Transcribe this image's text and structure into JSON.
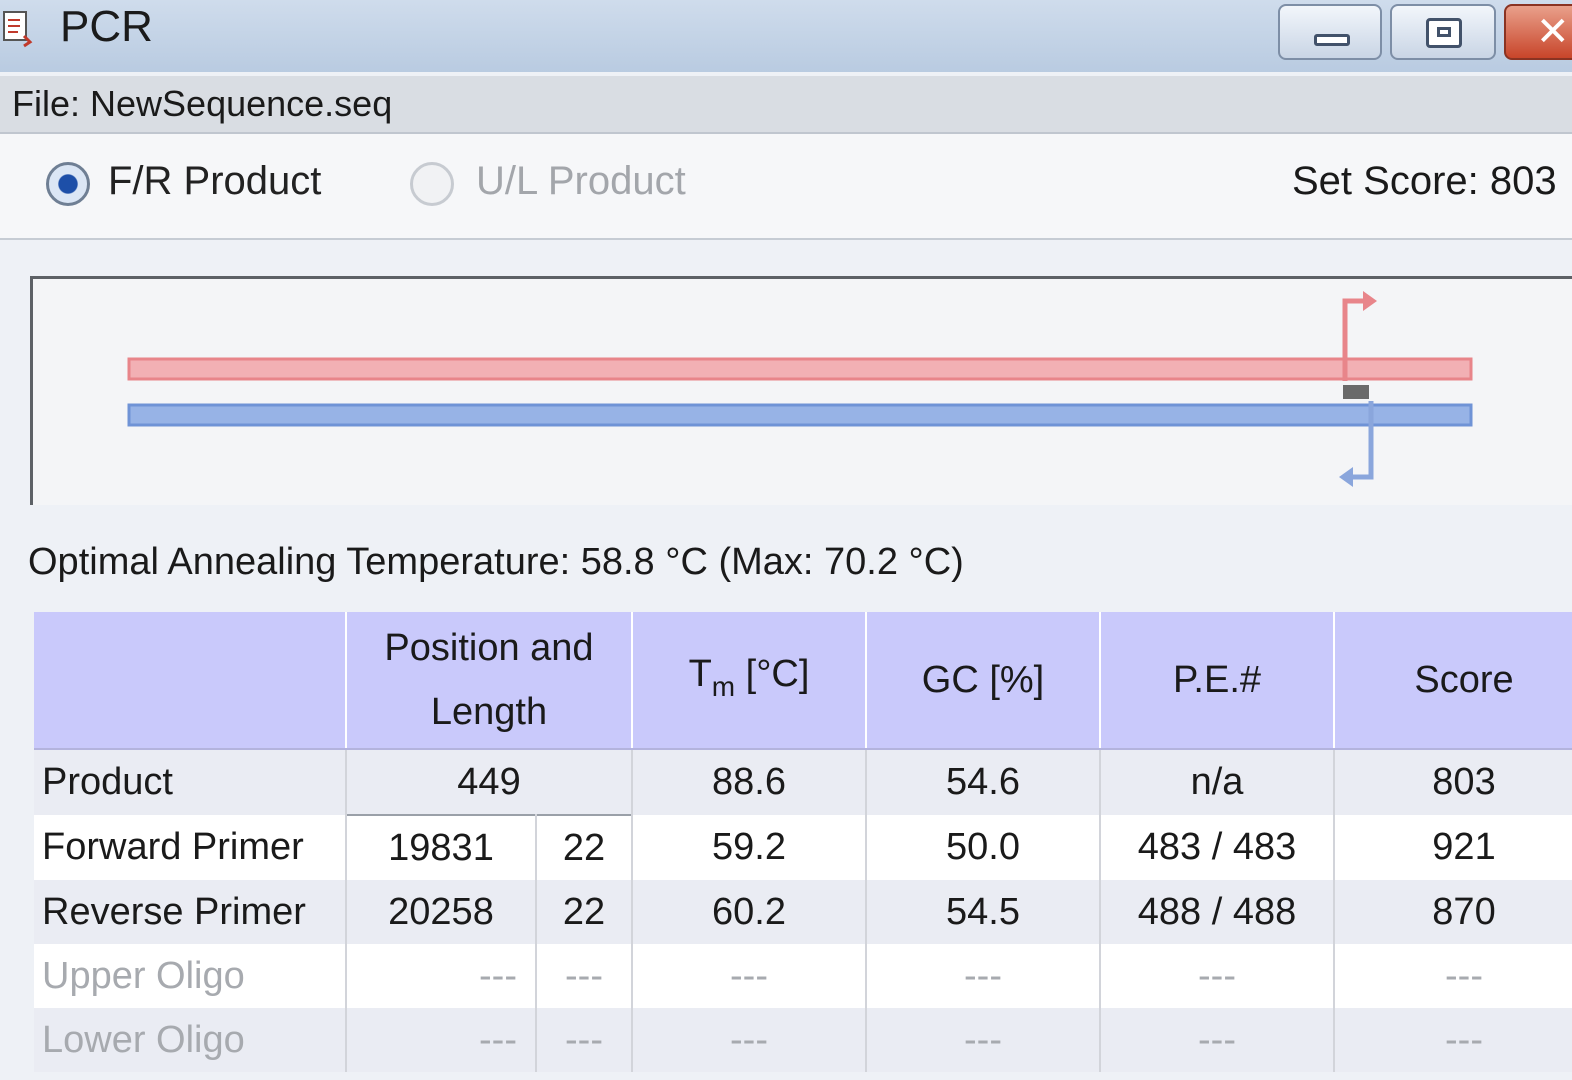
{
  "window": {
    "title": "PCR",
    "buttons": {
      "minimize": "minimize-icon",
      "maximize": "restore-icon",
      "close": "close-icon"
    }
  },
  "file": {
    "label": "File: NewSequence.seq"
  },
  "options": {
    "fr_product": "F/R Product",
    "ul_product": "U/L Product",
    "selected": "F/R Product",
    "set_score": "Set Score: 803"
  },
  "diagram": {
    "forward_color": "#e8858a",
    "reverse_color": "#6f93d6"
  },
  "annealing": {
    "text": "Optimal Annealing Temperature: 58.8 °C (Max: 70.2 °C)"
  },
  "table": {
    "headers": {
      "position_length_line1": "Position and",
      "position_length_line2": "Length",
      "tm_main": "T",
      "tm_sub": "m",
      "tm_unit": " [°C]",
      "gc": "GC [%]",
      "pe": "P.E.#",
      "score": "Score"
    },
    "rows": [
      {
        "name": "Product",
        "position": "449",
        "length": "",
        "tm": "88.6",
        "gc": "54.6",
        "pe": "n/a",
        "score": "803"
      },
      {
        "name": "Forward Primer",
        "position": "19831",
        "length": "22",
        "tm": "59.2",
        "gc": "50.0",
        "pe": "483 / 483",
        "score": "921"
      },
      {
        "name": "Reverse Primer",
        "position": "20258",
        "length": "22",
        "tm": "60.2",
        "gc": "54.5",
        "pe": "488 / 488",
        "score": "870"
      },
      {
        "name": "Upper Oligo",
        "position": "---",
        "length": "---",
        "tm": "---",
        "gc": "---",
        "pe": "---",
        "score": "---"
      },
      {
        "name": "Lower Oligo",
        "position": "---",
        "length": "---",
        "tm": "---",
        "gc": "---",
        "pe": "---",
        "score": "---"
      }
    ]
  }
}
